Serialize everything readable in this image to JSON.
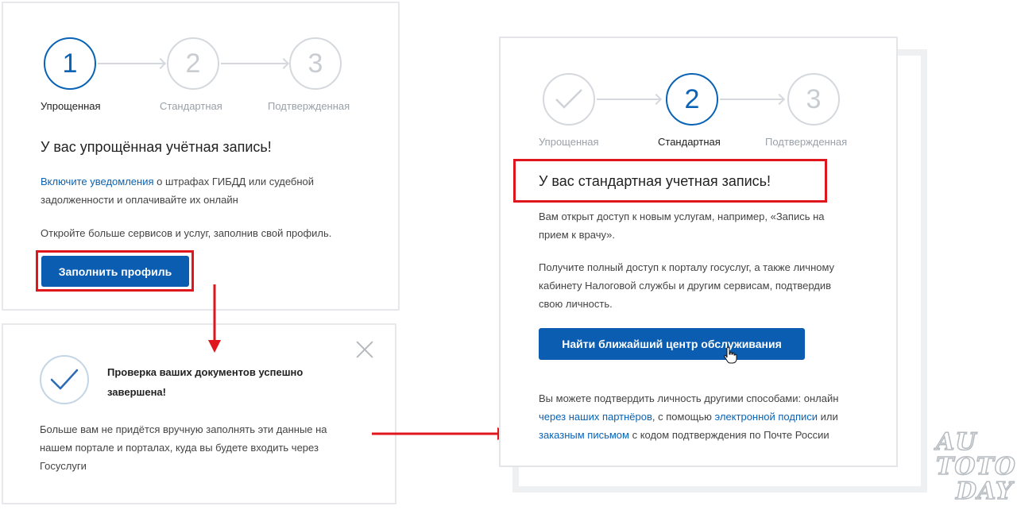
{
  "steps": [
    {
      "number": "1",
      "label": "Упрощенная"
    },
    {
      "number": "2",
      "label": "Стандартная"
    },
    {
      "number": "3",
      "label": "Подтвержденная"
    }
  ],
  "left_card": {
    "title": "У вас упрощённая учётная запись!",
    "notify_link": "Включите уведомления",
    "notify_text_1": " о штрафах ГИБДД или судебной",
    "notify_text_2": "задолженности и оплачивайте их онлайн",
    "profile_text": "Откройте больше сервисов и услуг, заполнив свой профиль.",
    "button": "Заполнить профиль"
  },
  "popup": {
    "title_1": "Проверка ваших документов успешно",
    "title_2": "завершена!",
    "body_1": "Больше вам не придётся вручную заполнять эти данные на",
    "body_2": "нашем портале и порталах, куда вы будете входить через",
    "body_3": "Госуслуги"
  },
  "right_card": {
    "title": "У вас стандартная учетная запись!",
    "access_1": "Вам открыт доступ к новым услугам, например, «Запись на",
    "access_2": "прием к врачу».",
    "full_1": "Получите полный доступ к порталу госуслуг, а также личному",
    "full_2": "кабинету Налоговой службы и другим сервисам, подтвердив",
    "full_3": "свою личность.",
    "button": "Найти ближайший центр обслуживания",
    "other_1": "Вы можете подтвердить личность другими способами: онлайн",
    "partners_link": "через наших партнёров",
    "other_2": ", с помощью ",
    "esign_link": "электронной подписи",
    "other_3": " или",
    "mail_link": "заказным письмом",
    "other_4": " с кодом подтверждения по Почте России"
  },
  "watermark": {
    "line1": "AU",
    "line2a": "TO",
    "line2b": "TO",
    "line3": "DAY"
  },
  "colors": {
    "accent": "#0a63b5",
    "button": "#0a5db0",
    "highlight": "#e0161d",
    "inactive": "#d5d9dd"
  }
}
